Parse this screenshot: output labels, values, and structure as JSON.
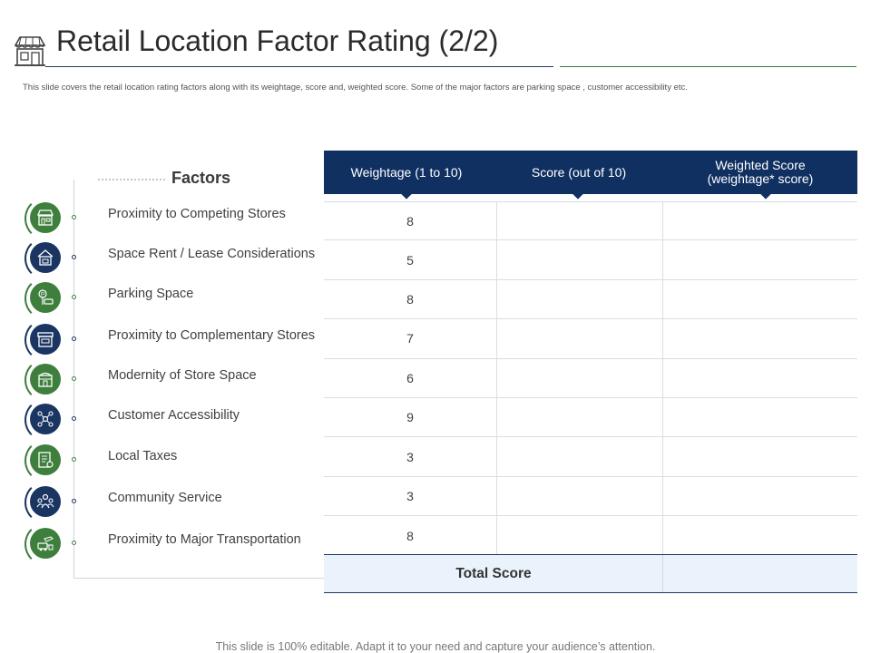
{
  "title": "Retail Location Factor Rating (2/2)",
  "subtitle": "This slide covers the retail location rating factors along with its weightage, score and, weighted score. Some of the major  factors are parking space , customer accessibility etc.",
  "factors_heading": "Factors",
  "table": {
    "headers": {
      "weightage": "Weightage (1 to 10)",
      "score": "Score (out of 10)",
      "weighted_line1": "Weighted Score",
      "weighted_line2": "(weightage* score)"
    },
    "rows": [
      {
        "factor": "Proximity to Competing Stores",
        "weightage": "8",
        "score": "",
        "weighted": "",
        "icon": "storefront-icon",
        "color": "green"
      },
      {
        "factor": "Space Rent / Lease Considerations",
        "weightage": "5",
        "score": "",
        "weighted": "",
        "icon": "house-lease-icon",
        "color": "navy"
      },
      {
        "factor": "Parking Space",
        "weightage": "8",
        "score": "",
        "weighted": "",
        "icon": "parking-icon",
        "color": "green"
      },
      {
        "factor": "Proximity to Complementary Stores",
        "weightage": "7",
        "score": "",
        "weighted": "",
        "icon": "shop-icon",
        "color": "navy"
      },
      {
        "factor": "Modernity of Store Space",
        "weightage": "6",
        "score": "",
        "weighted": "",
        "icon": "modern-store-icon",
        "color": "green"
      },
      {
        "factor": "Customer Accessibility",
        "weightage": "9",
        "score": "",
        "weighted": "",
        "icon": "network-icon",
        "color": "navy"
      },
      {
        "factor": "Local Taxes",
        "weightage": "3",
        "score": "",
        "weighted": "",
        "icon": "tax-document-icon",
        "color": "green"
      },
      {
        "factor": "Community Service",
        "weightage": "3",
        "score": "",
        "weighted": "",
        "icon": "community-icon",
        "color": "navy"
      },
      {
        "factor": "Proximity to Major Transportation",
        "weightage": "8",
        "score": "",
        "weighted": "",
        "icon": "transport-icon",
        "color": "green"
      }
    ],
    "total_label": "Total Score",
    "total_value": ""
  },
  "footer": "This slide is 100% editable. Adapt it to your need and capture your audience’s attention.",
  "colors": {
    "navy": "#0f3061",
    "green": "#3e7f3e",
    "total_bg": "#eaf3fb"
  }
}
